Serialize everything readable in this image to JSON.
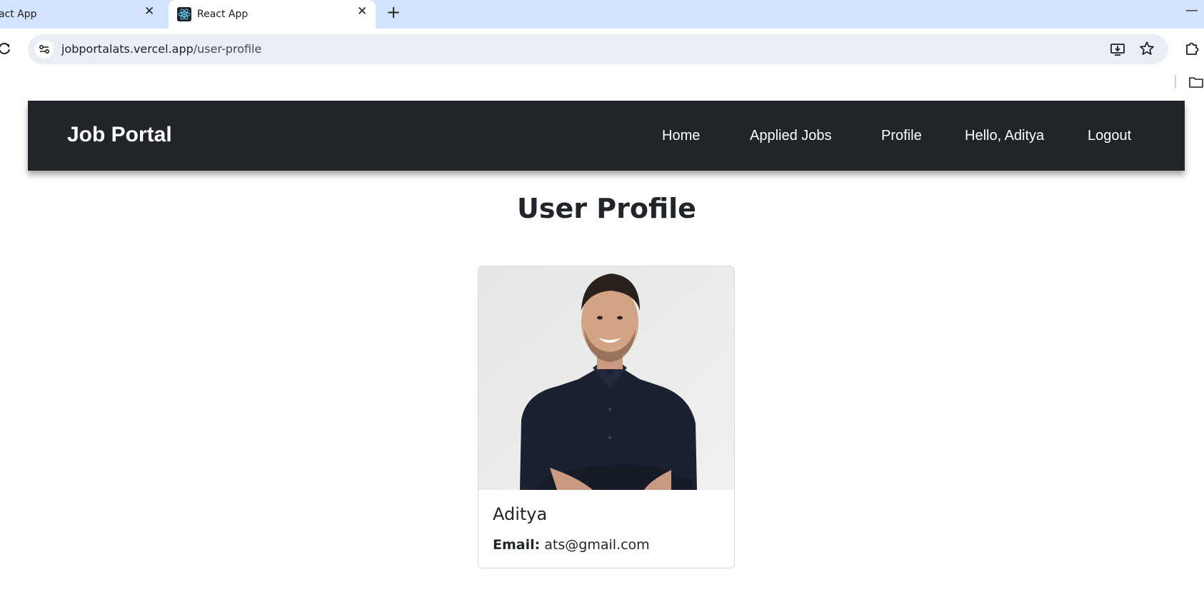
{
  "browser": {
    "tabs": [
      {
        "title": "act App",
        "active": false
      },
      {
        "title": "React App",
        "active": true
      }
    ],
    "url_domain": "jobportalats.vercel.app",
    "url_path": "/user-profile"
  },
  "navbar": {
    "brand": "Job Portal",
    "links": {
      "home": "Home",
      "applied_jobs": "Applied Jobs",
      "profile": "Profile",
      "greeting": "Hello, Aditya",
      "logout": "Logout"
    },
    "background": "#212529"
  },
  "main": {
    "title": "User Profile",
    "card": {
      "name": "Aditya",
      "email_label": "Email:",
      "email_value": "ats@gmail.com"
    }
  },
  "icons": [
    "react-logo-icon",
    "close-icon",
    "plus-icon",
    "minimize-icon",
    "reload-icon",
    "site-info-icon",
    "install-icon",
    "star-icon",
    "extensions-icon",
    "folder-icon"
  ]
}
